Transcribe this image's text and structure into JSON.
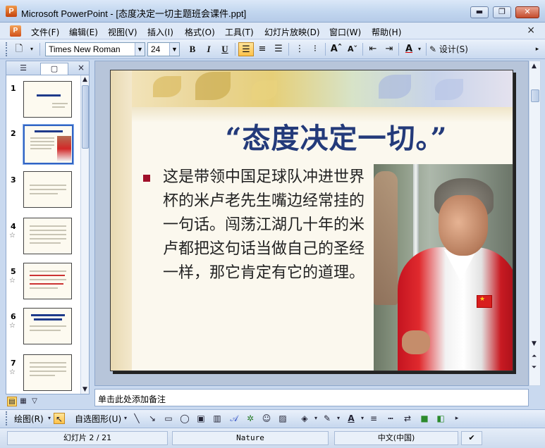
{
  "window": {
    "title": "Microsoft PowerPoint - [态度决定一切主题班会课件.ppt]",
    "app_icon_letter": "P",
    "minimize": "▬",
    "restore": "❐",
    "close": "✕"
  },
  "menu": {
    "items": [
      "文件(F)",
      "编辑(E)",
      "视图(V)",
      "插入(I)",
      "格式(O)",
      "工具(T)",
      "幻灯片放映(D)",
      "窗口(W)",
      "帮助(H)"
    ],
    "close": "×"
  },
  "toolbar": {
    "font_name": "Times New Roman",
    "font_size": "24",
    "bold": "B",
    "italic": "I",
    "underline": "U",
    "font_color": "A",
    "design_label": "设计(S)"
  },
  "panel": {
    "close": "×",
    "slide_numbers": [
      "1",
      "2",
      "3",
      "4",
      "5",
      "6",
      "7"
    ],
    "selected_slide": 2
  },
  "slide": {
    "title": "“态度决定一切。”",
    "body": "这是带领中国足球队冲进世界杯的米卢老先生嘴边经常挂的一句话。闯荡江湖几十年的米卢都把这句话当做自己的圣经一样，那它肯定有它的道理。"
  },
  "notes": {
    "placeholder": "单击此处添加备注"
  },
  "drawbar": {
    "draw_label": "绘图(R)",
    "autoshapes_label": "自选图形(U)"
  },
  "status": {
    "slide_position": "幻灯片 2 / 21",
    "design_template": "Nature",
    "language": "中文(中国)"
  },
  "colors": {
    "title_blue": "#233a7a",
    "bullet_red": "#a0102a",
    "selection_blue": "#3164c4"
  }
}
